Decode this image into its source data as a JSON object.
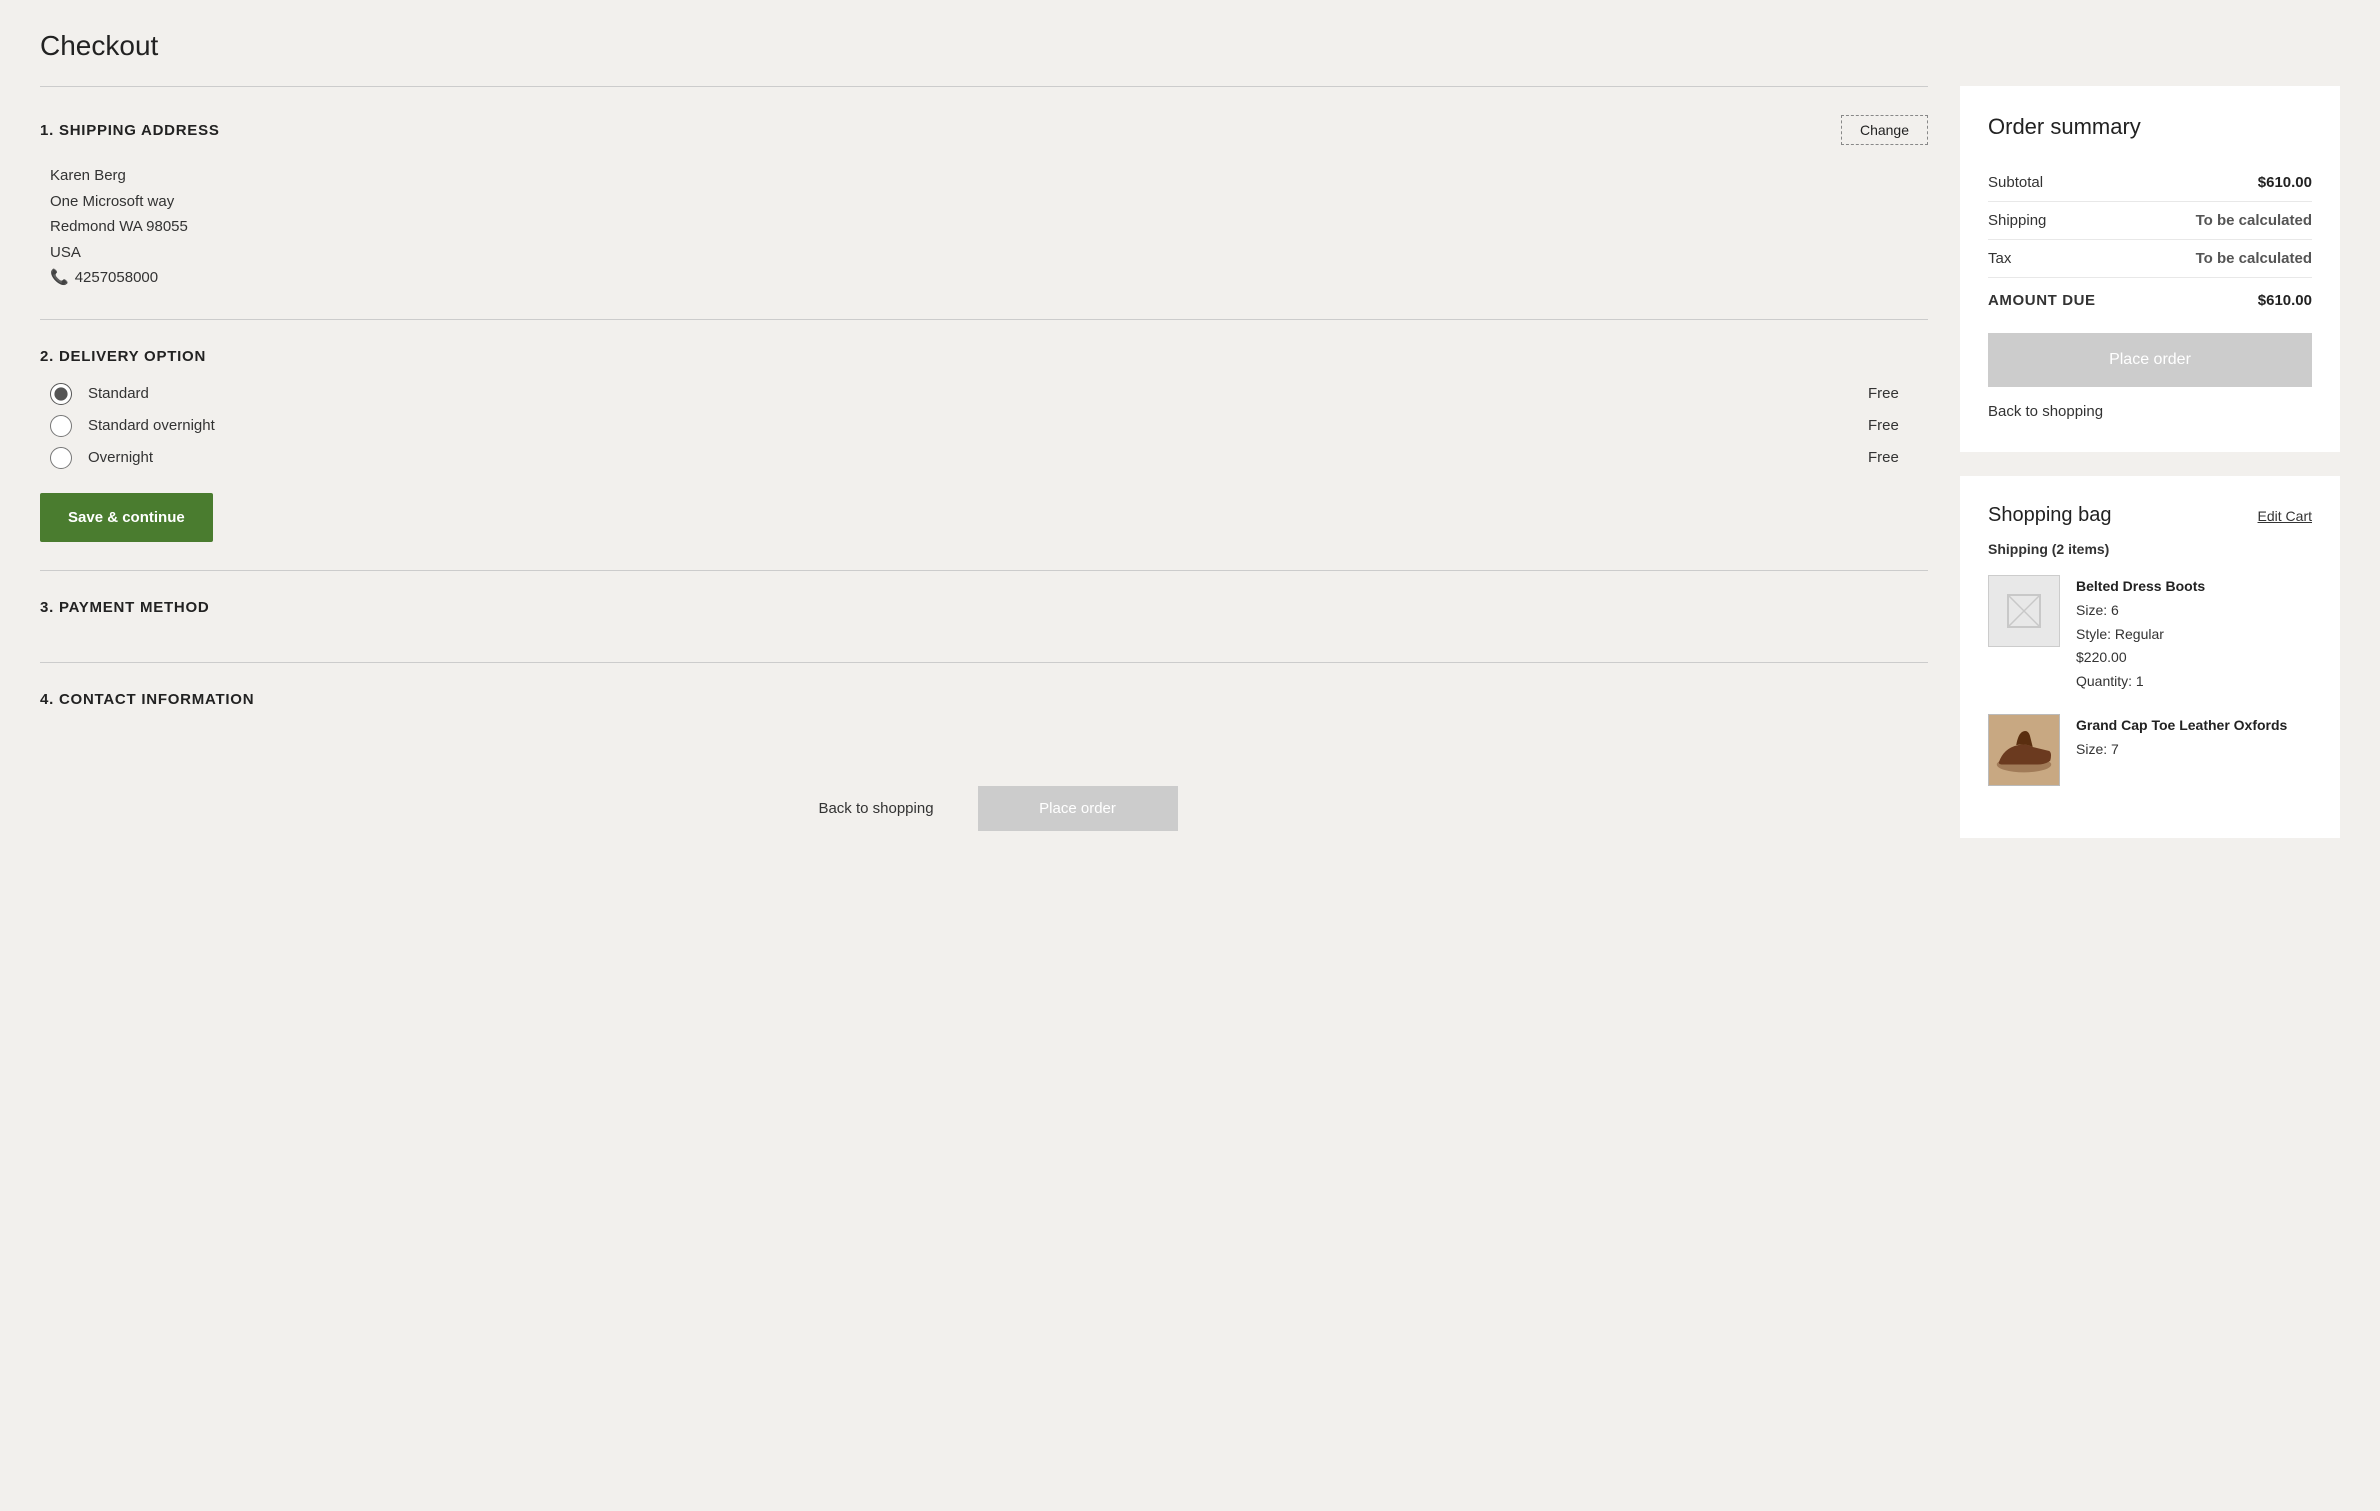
{
  "page": {
    "title": "Checkout"
  },
  "sections": {
    "shipping": {
      "number": "1.",
      "title": "SHIPPING ADDRESS",
      "change_label": "Change",
      "address": {
        "name": "Karen Berg",
        "street": "One Microsoft way",
        "city_state_zip": "Redmond WA  98055",
        "country": "USA",
        "phone": "4257058000"
      }
    },
    "delivery": {
      "number": "2.",
      "title": "DELIVERY OPTION",
      "options": [
        {
          "id": "standard",
          "label": "Standard",
          "price": "Free",
          "selected": true
        },
        {
          "id": "standard-overnight",
          "label": "Standard overnight",
          "price": "Free",
          "selected": false
        },
        {
          "id": "overnight",
          "label": "Overnight",
          "price": "Free",
          "selected": false
        }
      ],
      "save_button_label": "Save & continue"
    },
    "payment": {
      "number": "3.",
      "title": "PAYMENT METHOD"
    },
    "contact": {
      "number": "4.",
      "title": "CONTACT INFORMATION"
    }
  },
  "bottom_actions": {
    "back_label": "Back to shopping",
    "place_order_label": "Place order"
  },
  "order_summary": {
    "title": "Order summary",
    "rows": [
      {
        "label": "Subtotal",
        "value": "$610.00",
        "bold": true
      },
      {
        "label": "Shipping",
        "value": "To be calculated",
        "muted": true
      },
      {
        "label": "Tax",
        "value": "To be calculated",
        "muted": true
      }
    ],
    "total_label": "AMOUNT DUE",
    "total_value": "$610.00",
    "place_order_label": "Place order",
    "back_label": "Back to shopping"
  },
  "shopping_bag": {
    "title": "Shopping bag",
    "edit_label": "Edit Cart",
    "shipping_label": "Shipping (2 items)",
    "items": [
      {
        "name": "Belted Dress Boots",
        "size": "Size: 6",
        "style": "Style: Regular",
        "price": "$220.00",
        "quantity": "Quantity: 1",
        "has_image": false
      },
      {
        "name": "Grand Cap Toe Leather Oxfords",
        "size": "Size: 7",
        "style": "",
        "price": "",
        "quantity": "",
        "has_image": true
      }
    ]
  }
}
